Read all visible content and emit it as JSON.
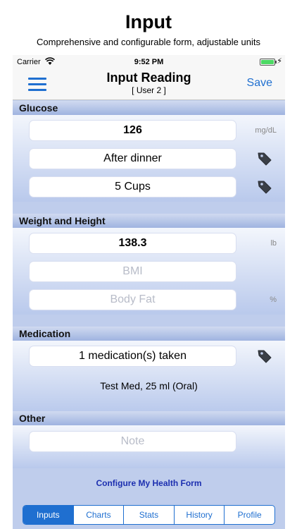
{
  "promo": {
    "title": "Input",
    "subtitle": "Comprehensive and configurable form, adjustable units"
  },
  "status": {
    "carrier": "Carrier",
    "time": "9:52 PM"
  },
  "nav": {
    "title": "Input Reading",
    "subtitle": "[ User 2 ]",
    "save_label": "Save"
  },
  "glucose": {
    "header": "Glucose",
    "value": "126",
    "unit": "mg/dL",
    "meal": "After dinner",
    "food": "5 Cups"
  },
  "weight": {
    "header": "Weight and Height",
    "value": "138.3",
    "unit": "lb",
    "bmi_placeholder": "BMI",
    "bodyfat_placeholder": "Body Fat",
    "bodyfat_unit": "%"
  },
  "medication": {
    "header": "Medication",
    "taken": "1 medication(s) taken",
    "detail": "Test Med, 25 ml (Oral)"
  },
  "other": {
    "header": "Other",
    "note_placeholder": "Note"
  },
  "footer": {
    "configure_label": "Configure My Health Form"
  },
  "tabs": [
    {
      "label": "Inputs",
      "active": true
    },
    {
      "label": "Charts",
      "active": false
    },
    {
      "label": "Stats",
      "active": false
    },
    {
      "label": "History",
      "active": false
    },
    {
      "label": "Profile",
      "active": false
    }
  ],
  "colors": {
    "accent": "#1f6fd0",
    "link": "#1c2fb0",
    "background": "#bfcdec"
  }
}
